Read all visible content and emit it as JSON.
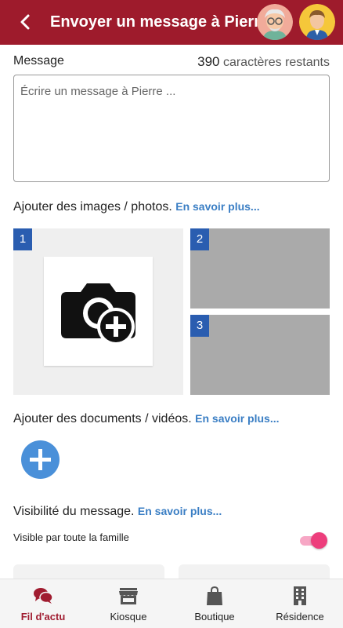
{
  "header": {
    "title": "Envoyer un message à Pierre",
    "background": "#9e1b2c"
  },
  "message": {
    "label": "Message",
    "remaining_count": "390",
    "remaining_text": "caractères restants",
    "placeholder": "Écrire un message à Pierre ..."
  },
  "images": {
    "label": "Ajouter des images / photos.",
    "link": "En savoir plus...",
    "slots": [
      "1",
      "2",
      "3"
    ]
  },
  "documents": {
    "label": "Ajouter des documents / vidéos.",
    "link": "En savoir plus..."
  },
  "visibility": {
    "label": "Visibilité du message.",
    "link": "En savoir plus...",
    "toggle_label": "Visible par toute la famille",
    "toggle_on": true
  },
  "bottom_nav": {
    "items": [
      {
        "label": "Fil d'actu",
        "icon": "chat-bubbles-icon",
        "active": true
      },
      {
        "label": "Kiosque",
        "icon": "shop-icon",
        "active": false
      },
      {
        "label": "Boutique",
        "icon": "shopping-bag-icon",
        "active": false
      },
      {
        "label": "Résidence",
        "icon": "building-icon",
        "active": false
      }
    ]
  },
  "colors": {
    "accent_link": "#3a7ec4",
    "slot_number": "#2a5db0",
    "add_button": "#4a90d9",
    "toggle": "#ed3e7c",
    "nav_active": "#a01c30"
  }
}
